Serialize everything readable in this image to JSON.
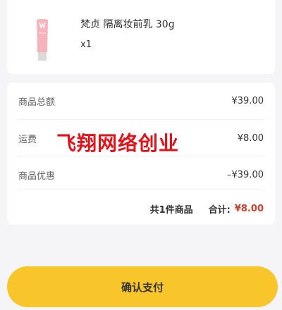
{
  "product": {
    "name": "梵贞 隔离妆前乳 30g",
    "quantity": "x1"
  },
  "summary": {
    "rows": [
      {
        "label": "商品总额",
        "value": "¥39.00"
      },
      {
        "label": "运费",
        "value": "¥8.00"
      },
      {
        "label": "商品优惠",
        "value": "–¥39.00"
      }
    ],
    "count_text": "共1件商品",
    "total_label": "合计:",
    "total_value": "¥8.00"
  },
  "watermark": "飞翔网络创业",
  "pay_button_label": "确认支付",
  "colors": {
    "accent": "#f8c62a",
    "price_red": "#c9402e",
    "watermark_red": "#e3111a"
  }
}
